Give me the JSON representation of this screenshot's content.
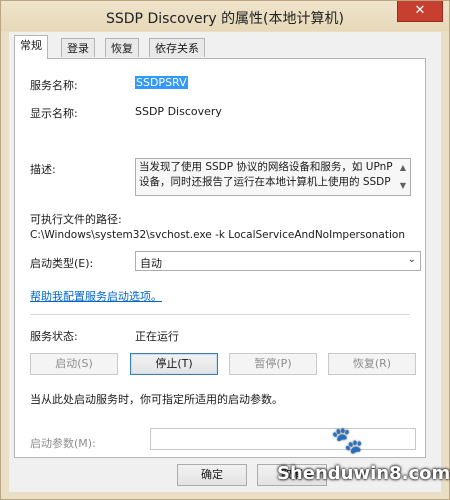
{
  "window": {
    "title": "SSDP Discovery 的属性(本地计算机)",
    "close_glyph": "✕"
  },
  "tabs": [
    {
      "label": "常规",
      "active": true
    },
    {
      "label": "登录",
      "active": false
    },
    {
      "label": "恢复",
      "active": false
    },
    {
      "label": "依存关系",
      "active": false
    }
  ],
  "general": {
    "service_name_label": "服务名称:",
    "service_name_value": "SSDPSRV",
    "display_name_label": "显示名称:",
    "display_name_value": "SSDP Discovery",
    "description_label": "描述:",
    "description_text": "当发现了使用 SSDP 协议的网络设备和服务，如 UPnP 设备，同时还报告了运行在本地计算机上使用的 SSDP",
    "exe_path_label": "可执行文件的路径:",
    "exe_path_value": "C:\\Windows\\system32\\svchost.exe -k LocalServiceAndNoImpersonation",
    "startup_type_label": "启动类型(E):",
    "startup_type_value": "自动",
    "help_link": "帮助我配置服务启动选项。",
    "status_label": "服务状态:",
    "status_value": "正在运行",
    "buttons": {
      "start": "启动(S)",
      "stop": "停止(T)",
      "pause": "暂停(P)",
      "resume": "恢复(R)"
    },
    "hint_text": "当从此处启动服务时，你可指定所适用的启动参数。",
    "start_params_label": "启动参数(M):",
    "start_params_value": ""
  },
  "footer": {
    "ok": "确定",
    "cancel": "取消"
  },
  "watermark": {
    "text": "Shenduwin8.com"
  },
  "icons": [
    "close-icon",
    "scroll-up-icon",
    "scroll-down-icon",
    "chevron-down-icon"
  ]
}
